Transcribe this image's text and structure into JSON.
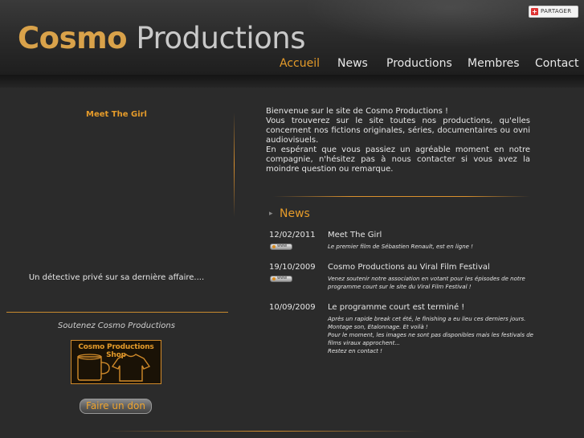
{
  "header": {
    "logo_bold": "Cosmo",
    "logo_light": "Productions",
    "share_label": "PARTAGER"
  },
  "nav": {
    "items": [
      {
        "label": "Accueil",
        "active": true
      },
      {
        "label": "News",
        "active": false
      },
      {
        "label": "Productions",
        "active": false
      },
      {
        "label": "Membres",
        "active": false
      },
      {
        "label": "Contact",
        "active": false
      }
    ]
  },
  "sidebar": {
    "slide_title": "Meet The Girl",
    "slide_caption": "Un détective privé sur sa dernière affaire....",
    "support_title": "Soutenez Cosmo Productions",
    "shop_label": "Cosmo Productions Shop",
    "donate_label": "Faire un don"
  },
  "intro": {
    "lines": [
      "Bienvenue sur le site de Cosmo Productions !",
      "Vous trouverez sur le site toutes nos productions, qu'elles concernent nos fictions originales, séries, documentaires ou ovni audiovisuels.",
      "En espérant que vous passiez un agréable moment en notre compagnie, n'hésitez pas à nous contacter si vous avez la moindre question ou remarque."
    ]
  },
  "news": {
    "title": "News",
    "www_label": "www",
    "items": [
      {
        "date": "12/02/2011",
        "headline": "Meet The Girl",
        "description": "Le premier film de Sébastien Renault, est en ligne !",
        "has_link": true
      },
      {
        "date": "19/10/2009",
        "headline": "Cosmo Productions au Viral Film Festival",
        "description": "Venez soutenir notre association en votant pour les épisodes de notre programme court sur le site du Viral Film Festival !",
        "has_link": true
      },
      {
        "date": "10/09/2009",
        "headline": "Le programme court est terminé !",
        "description_lines": [
          "Après un rapide break cet été, le finishing a eu lieu ces derniers jours.",
          "Montage son, Etalonnage. Et voilà !",
          "Pour le moment, les images ne sont pas disponibles mais les festivals de films viraux approchent...",
          "Restez en contact !"
        ],
        "has_link": false
      }
    ]
  },
  "colors": {
    "accent": "#e59b2a",
    "background": "#2b2b2b",
    "text": "#e6e6e6"
  }
}
